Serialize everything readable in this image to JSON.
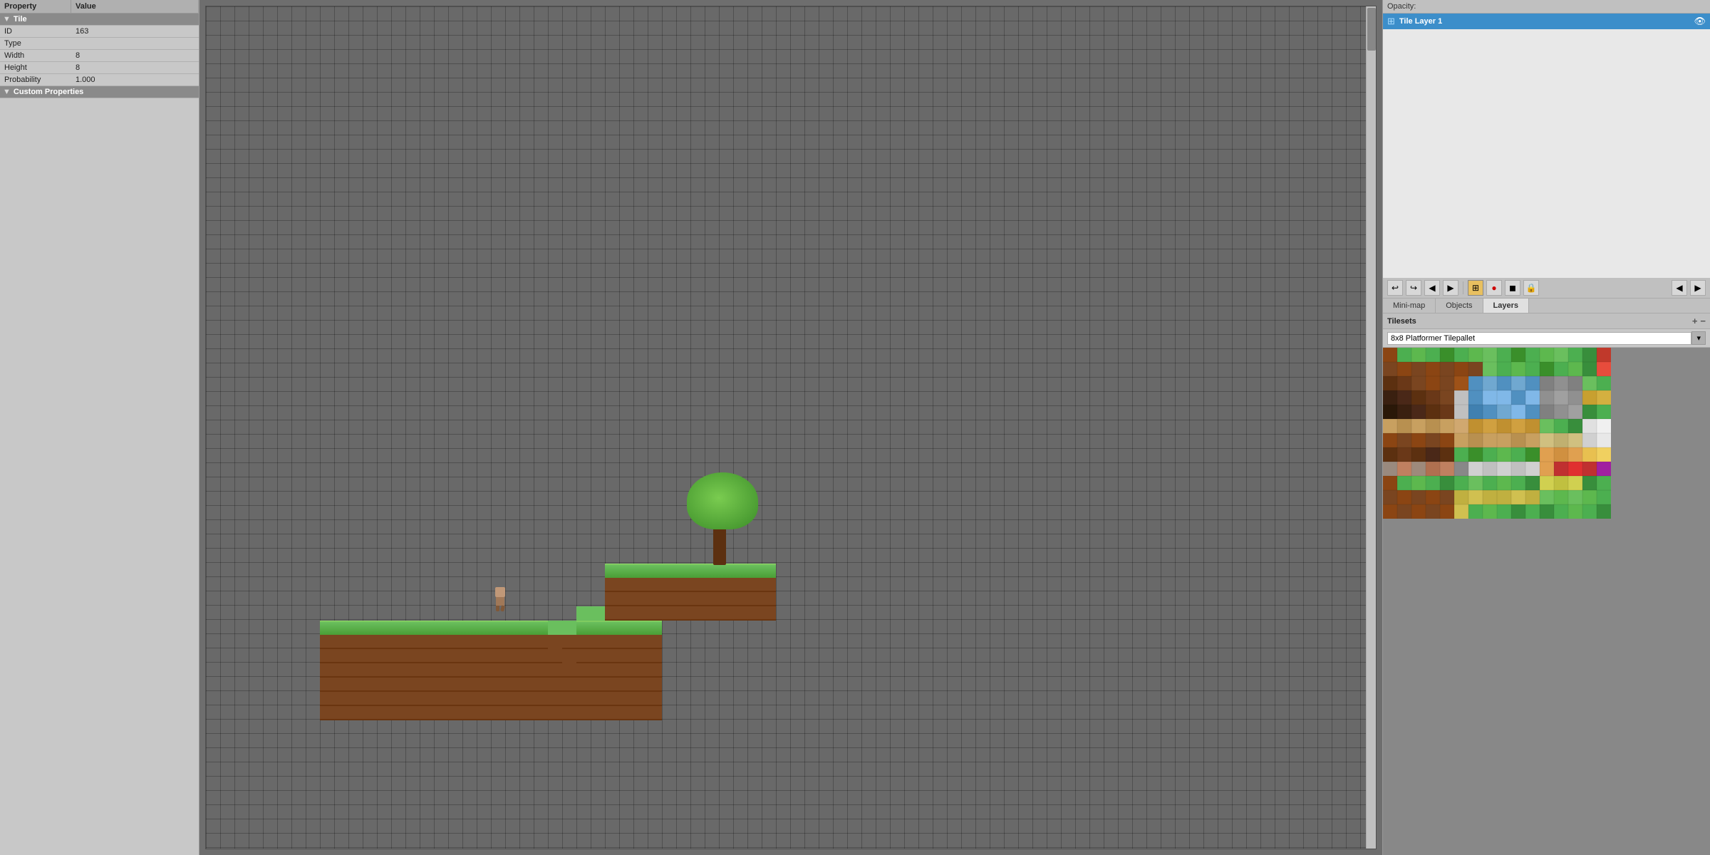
{
  "left_panel": {
    "headers": {
      "property": "Property",
      "value": "Value"
    },
    "tile_section": {
      "label": "Tile"
    },
    "properties": [
      {
        "name": "ID",
        "value": "163"
      },
      {
        "name": "Type",
        "value": ""
      },
      {
        "name": "Width",
        "value": "8"
      },
      {
        "name": "Height",
        "value": "8"
      },
      {
        "name": "Probability",
        "value": "1.000"
      }
    ],
    "custom_properties": {
      "label": "Custom Properties"
    }
  },
  "right_panel": {
    "opacity_label": "Opacity:",
    "layers": {
      "tile_layer_1": "Tile Layer 1"
    },
    "tabs": [
      {
        "id": "mini-map",
        "label": "Mini-map"
      },
      {
        "id": "objects",
        "label": "Objects"
      },
      {
        "id": "layers",
        "label": "Layers",
        "active": true
      }
    ],
    "tilesets": {
      "label": "Tilesets",
      "selected": "8x8 Platformer Tilepallet"
    }
  },
  "toolbar": {
    "buttons": [
      "↩",
      "↪",
      "◀",
      "▶",
      "⊞",
      "🔴",
      "◼",
      "🔒"
    ]
  },
  "canvas": {
    "grid_visible": true
  }
}
